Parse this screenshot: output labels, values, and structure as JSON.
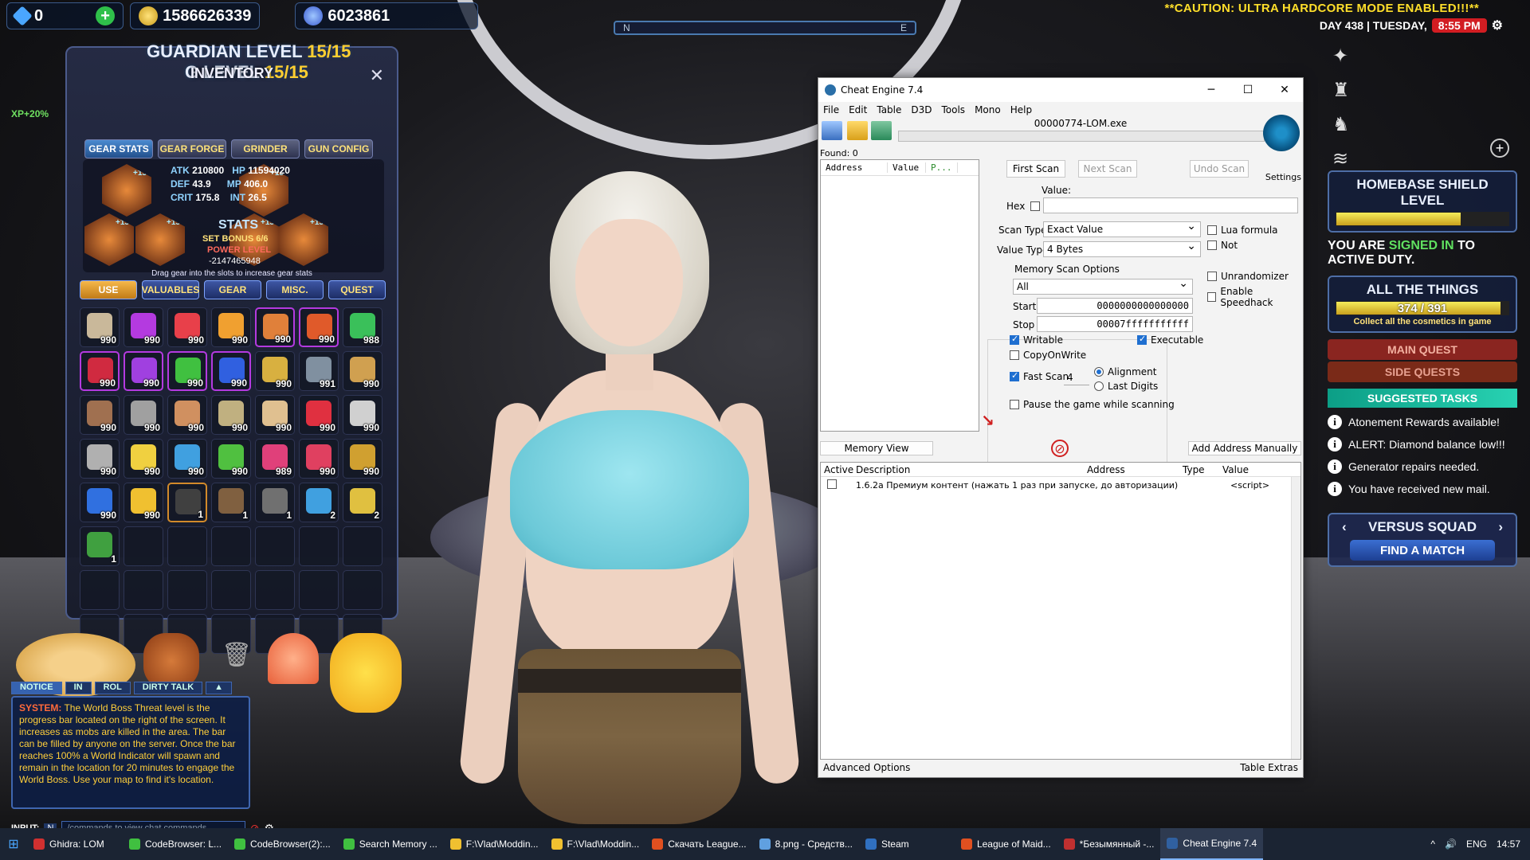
{
  "hud": {
    "gems": "0",
    "gold": "1586626339",
    "diamonds": "6023861",
    "guardian_prefix": "GUARDIAN LEVEL",
    "guardian_level": "15/15",
    "char_level_suffix": "G LEVEL",
    "char_level": "15/15",
    "xp_bonus": "XP+20%",
    "search_bar_left": "N",
    "search_bar_right": "E",
    "caution": "**CAUTION: ULTRA HARDCORE MODE ENABLED!!!**",
    "day": "DAY 438 | TUESDAY,",
    "time": "8:55 PM"
  },
  "inventory": {
    "title": "INVENTORY",
    "tabs": [
      "GEAR STATS",
      "GEAR FORGE",
      "GRINDER",
      "GUN CONFIG"
    ],
    "stats": {
      "atk_label": "ATK",
      "atk": "210800",
      "hp_label": "HP",
      "hp": "11594020",
      "def_label": "DEF",
      "def": "43.9",
      "mp_label": "MP",
      "mp": "406.0",
      "crit_label": "CRIT",
      "crit": "175.8",
      "int_label": "INT",
      "int": "26.5"
    },
    "stats_label": "STATS",
    "set_bonus": "SET BONUS 6/6",
    "power_level_label": "POWER LEVEL",
    "power_level": "-2147465948",
    "drag_hint": "Drag gear into the slots to increase gear stats",
    "gear_badge": "+15",
    "categories": [
      "USE",
      "VALUABLES",
      "GEAR",
      "MISC.",
      "QUEST"
    ],
    "items": [
      {
        "qty": "990",
        "color": "#c9b89a",
        "frame": ""
      },
      {
        "qty": "990",
        "color": "#b43ae0",
        "frame": ""
      },
      {
        "qty": "990",
        "color": "#e8404a",
        "frame": ""
      },
      {
        "qty": "990",
        "color": "#f0a030",
        "frame": ""
      },
      {
        "qty": "990",
        "color": "#e0803a",
        "frame": "purple"
      },
      {
        "qty": "990",
        "color": "#e05a2a",
        "frame": "purple"
      },
      {
        "qty": "988",
        "color": "#3ac05a",
        "frame": ""
      },
      {
        "qty": "990",
        "color": "#d02a40",
        "frame": "purple"
      },
      {
        "qty": "990",
        "color": "#a040e0",
        "frame": "purple"
      },
      {
        "qty": "990",
        "color": "#40c040",
        "frame": "purple"
      },
      {
        "qty": "990",
        "color": "#3060e0",
        "frame": "purple"
      },
      {
        "qty": "990",
        "color": "#d8b040",
        "frame": ""
      },
      {
        "qty": "991",
        "color": "#8090a0",
        "frame": ""
      },
      {
        "qty": "990",
        "color": "#d0a050",
        "frame": ""
      },
      {
        "qty": "990",
        "color": "#a07050",
        "frame": ""
      },
      {
        "qty": "990",
        "color": "#a0a0a0",
        "frame": ""
      },
      {
        "qty": "990",
        "color": "#d09060",
        "frame": ""
      },
      {
        "qty": "990",
        "color": "#c0b080",
        "frame": ""
      },
      {
        "qty": "990",
        "color": "#e0c090",
        "frame": ""
      },
      {
        "qty": "990",
        "color": "#e03040",
        "frame": ""
      },
      {
        "qty": "990",
        "color": "#d0d0d0",
        "frame": ""
      },
      {
        "qty": "990",
        "color": "#b0b0b0",
        "frame": ""
      },
      {
        "qty": "990",
        "color": "#f0d040",
        "frame": ""
      },
      {
        "qty": "990",
        "color": "#40a0e0",
        "frame": ""
      },
      {
        "qty": "990",
        "color": "#50c040",
        "frame": ""
      },
      {
        "qty": "989",
        "color": "#e0407a",
        "frame": ""
      },
      {
        "qty": "990",
        "color": "#e04060",
        "frame": ""
      },
      {
        "qty": "990",
        "color": "#d0a030",
        "frame": ""
      },
      {
        "qty": "990",
        "color": "#3070e0",
        "frame": ""
      },
      {
        "qty": "990",
        "color": "#f0c030",
        "frame": ""
      },
      {
        "qty": "1",
        "color": "#404040",
        "frame": "gold"
      },
      {
        "qty": "1",
        "color": "#806040",
        "frame": ""
      },
      {
        "qty": "1",
        "color": "#707070",
        "frame": ""
      },
      {
        "qty": "2",
        "color": "#40a0e0",
        "frame": ""
      },
      {
        "qty": "2",
        "color": "#e0c040",
        "frame": ""
      },
      {
        "qty": "1",
        "color": "#40a040",
        "frame": ""
      }
    ],
    "empty_slots": 20
  },
  "chat": {
    "tabs": [
      "NOTICE",
      "IN",
      "ROL",
      "DIRTY TALK"
    ],
    "system_label": "SYSTEM:",
    "message": "The World Boss Threat level is the progress bar located on the right of the screen. It increases as mobs are killed in the area. The bar can be filled by anyone on the server. Once the bar reaches 100% a World Indicator will spawn and remain in the location for 20 minutes to engage the World Boss. Use your map to find it's location.",
    "input_label": "INPUT:",
    "input_mode": "N",
    "input_placeholder": "/commands to view chat commands"
  },
  "right_hud": {
    "homebase_title": "HOMEBASE SHIELD LEVEL",
    "homebase_fill": 0.72,
    "duty_pre": "YOU ARE",
    "duty_hl": "SIGNED IN",
    "duty_post": "TO ACTIVE DUTY.",
    "things_title": "ALL THE THINGS",
    "things_progress": "374 / 391",
    "things_fill": 0.956,
    "things_note": "Collect all the cosmetics in game",
    "main_quest": "MAIN QUEST",
    "side_quests": "SIDE QUESTS",
    "suggested": "SUGGESTED TASKS",
    "tasks": [
      "Atonement Rewards available!",
      "ALERT: Diamond balance low!!!",
      "Generator repairs needed.",
      "You have received new mail."
    ],
    "versus": "VERSUS SQUAD",
    "find_match": "FIND A MATCH"
  },
  "cheat_engine": {
    "title": "Cheat Engine 7.4",
    "menu": [
      "File",
      "Edit",
      "Table",
      "D3D",
      "Tools",
      "Mono",
      "Help"
    ],
    "process": "00000774-LOM.exe",
    "found": "Found: 0",
    "list_headers": [
      "Address",
      "Value",
      "P..."
    ],
    "first_scan": "First Scan",
    "next_scan": "Next Scan",
    "undo_scan": "Undo Scan",
    "settings": "Settings",
    "value_label": "Value:",
    "hex_label": "Hex",
    "scan_type_label": "Scan Type",
    "scan_type": "Exact Value",
    "value_type_label": "Value Type",
    "value_type": "4 Bytes",
    "lua_formula": "Lua formula",
    "not_label": "Not",
    "memory_scan_options": "Memory Scan Options",
    "region": "All",
    "start_label": "Start",
    "start": "0000000000000000",
    "stop_label": "Stop",
    "stop": "00007fffffffffff",
    "writable": "Writable",
    "executable": "Executable",
    "copy_on_write": "CopyOnWrite",
    "fast_scan": "Fast Scan",
    "fast_scan_value": "4",
    "alignment": "Alignment",
    "last_digits": "Last Digits",
    "pause": "Pause the game while scanning",
    "unrandomizer": "Unrandomizer",
    "speedhack": "Enable Speedhack",
    "memory_view": "Memory View",
    "add_address": "Add Address Manually",
    "table_headers": [
      "Active",
      "Description",
      "Address",
      "Type",
      "Value"
    ],
    "table_rows": [
      {
        "description": "1.6.2a Премиум контент (нажать 1 раз при запуске, до авторизации)",
        "address": "",
        "type": "",
        "value": "<script>"
      }
    ],
    "advanced_options": "Advanced Options",
    "table_extras": "Table Extras"
  },
  "taskbar": {
    "items": [
      {
        "label": "Ghidra: LOM",
        "color": "#d03030"
      },
      {
        "label": "CodeBrowser: L...",
        "color": "#40c040"
      },
      {
        "label": "CodeBrowser(2):...",
        "color": "#40c040"
      },
      {
        "label": "Search Memory ...",
        "color": "#40c040"
      },
      {
        "label": "F:\\Vlad\\Moddin...",
        "color": "#f0c030"
      },
      {
        "label": "F:\\Vlad\\Moddin...",
        "color": "#f0c030"
      },
      {
        "label": "Скачать League...",
        "color": "#e05020"
      },
      {
        "label": "8.png - Средств...",
        "color": "#60a0e0"
      },
      {
        "label": "Steam",
        "color": "#3070c0"
      },
      {
        "label": "League of Maid...",
        "color": "#e05020"
      },
      {
        "label": "*Безымянный -...",
        "color": "#c03030"
      },
      {
        "label": "Cheat Engine 7.4",
        "color": "#3060a0"
      }
    ],
    "lang": "ENG",
    "clock": "14:57"
  }
}
